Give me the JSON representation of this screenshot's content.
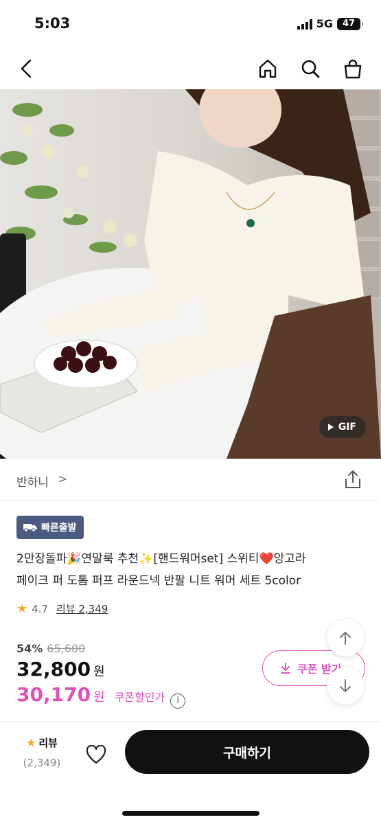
{
  "status": {
    "time": "5:03",
    "network": "5G",
    "battery": "47"
  },
  "nav": {
    "back_icon": "chevron-left-icon",
    "home_icon": "home-icon",
    "search_icon": "search-icon",
    "cart_icon": "shopping-bag-icon"
  },
  "hero": {
    "gif_label": "GIF"
  },
  "seller": {
    "name": "반하니",
    "chevron": ">"
  },
  "badge": {
    "fast_delivery": "빠른출발"
  },
  "product": {
    "title_line1": "2만장돌파🎉연말룩 추천✨[핸드워머set] 스위티❤️앙고라",
    "title_line2": "페이크 퍼 도톰 퍼프 라운드넥 반팔 니트 워머 세트 5color"
  },
  "rating": {
    "value": "4.7",
    "review_label": "리뷰 2,349"
  },
  "price": {
    "discount_rate": "54%",
    "original": "65,600",
    "sale": "32,800",
    "currency": "원",
    "coupon_price": "30,170",
    "coupon_currency": "원",
    "coupon_label": "쿠폰할인가",
    "info_symbol": "i"
  },
  "coupon_button": {
    "label": "쿠폰 받기"
  },
  "bottom": {
    "review_label": "리뷰",
    "review_count": "(2,349)",
    "buy_label": "구매하기"
  },
  "colors": {
    "accent_pink": "#e34fb9",
    "badge_navy": "#4a5a80",
    "star": "#f5a623"
  }
}
